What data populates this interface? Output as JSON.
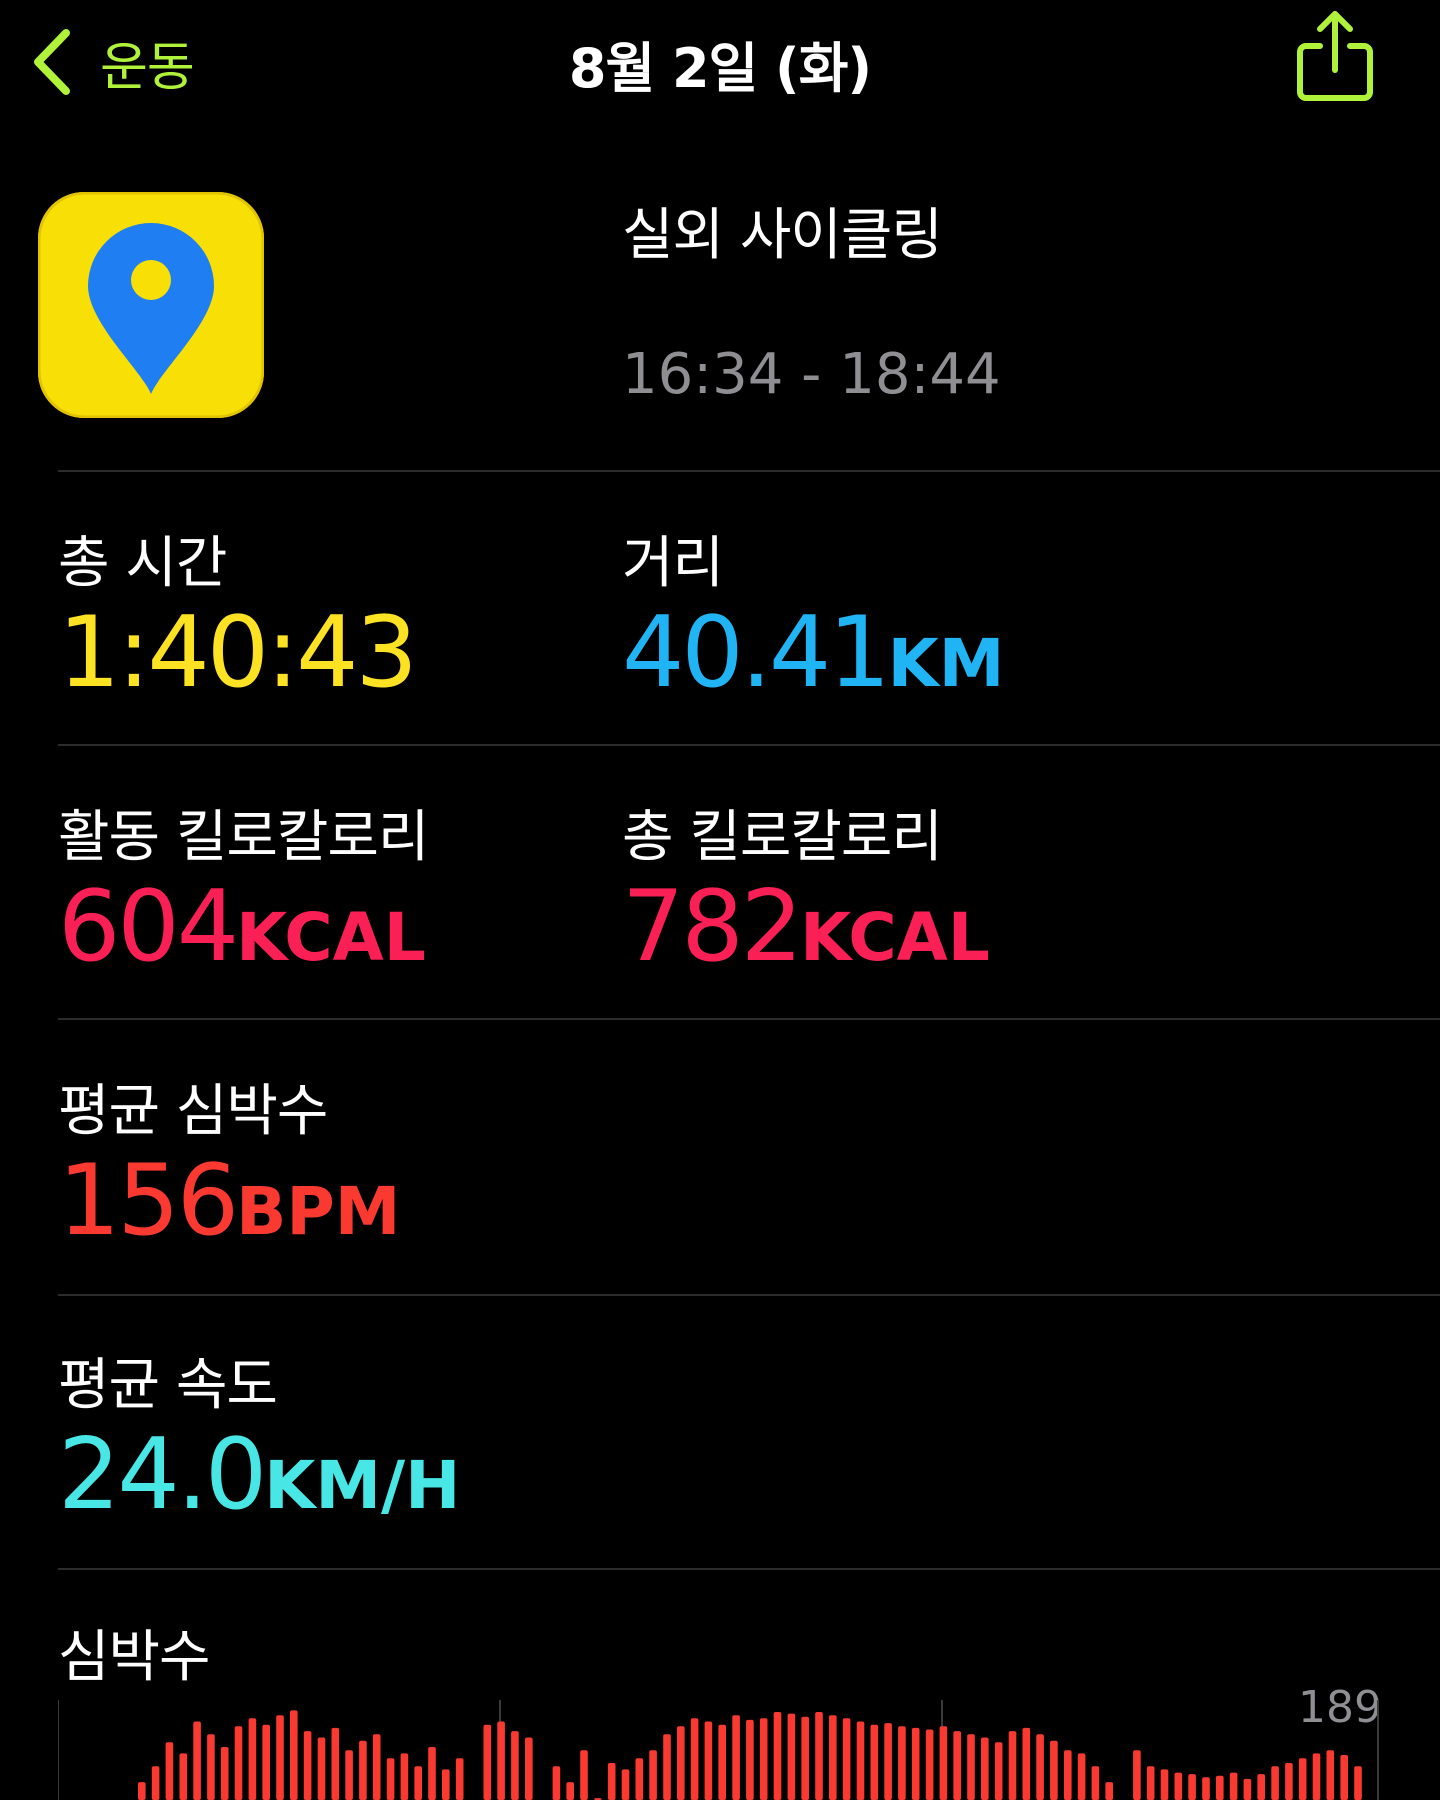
{
  "nav": {
    "back_label": "운동",
    "title": "8월 2일 (화)",
    "back_icon": "chevron-left-icon",
    "share_icon": "share-icon",
    "accent_color": "#b0f23a"
  },
  "workout": {
    "app_icon": "map-pin-app-icon",
    "title": "실외 사이클링",
    "time_range": "16:34 - 18:44"
  },
  "metrics": {
    "total_time": {
      "label": "총 시간",
      "value": "1:40:43",
      "color": "#fde223"
    },
    "distance": {
      "label": "거리",
      "value": "40.41",
      "unit": "KM",
      "color": "#20b4f5"
    },
    "active_kcal": {
      "label": "활동 킬로칼로리",
      "value": "604",
      "unit": "KCAL",
      "color": "#fa1f55"
    },
    "total_kcal": {
      "label": "총 킬로칼로리",
      "value": "782",
      "unit": "KCAL",
      "color": "#fa1f55"
    },
    "avg_hr": {
      "label": "평균 심박수",
      "value": "156",
      "unit": "BPM",
      "color": "#fa3a30"
    },
    "avg_speed": {
      "label": "평균 속도",
      "value": "24.0",
      "unit": "KM/H",
      "color": "#49e6e6"
    }
  },
  "heart_chart": {
    "title": "심박수",
    "max_label": "189",
    "color": "#fa3a30",
    "chart_data": {
      "type": "bar",
      "title": "심박수",
      "y_max": 189,
      "note": "heart-rate range bars across workout; only top portion visible",
      "values": [
        140,
        150,
        165,
        158,
        178,
        170,
        162,
        175,
        180,
        176,
        182,
        185,
        172,
        168,
        174,
        160,
        166,
        170,
        155,
        158,
        150,
        162,
        148,
        155,
        0,
        176,
        178,
        172,
        168,
        0,
        150,
        140,
        160,
        130,
        152,
        148,
        155,
        160,
        170,
        175,
        180,
        178,
        176,
        182,
        179,
        180,
        184,
        183,
        181,
        184,
        182,
        180,
        178,
        176,
        177,
        175,
        174,
        173,
        175,
        172,
        170,
        168,
        165,
        172,
        174,
        170,
        166,
        160,
        158,
        150,
        140,
        0,
        160,
        150,
        148,
        146,
        145,
        143,
        144,
        146,
        142,
        145,
        150,
        152,
        155,
        158,
        160,
        157,
        150
      ]
    }
  }
}
